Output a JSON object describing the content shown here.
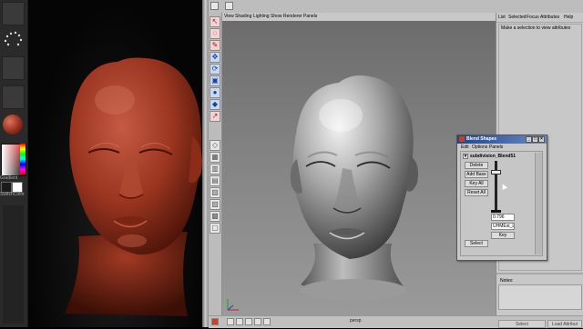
{
  "zbrush": {
    "gradient_label": "Gradient",
    "switch_label": "SwitchColor"
  },
  "maya": {
    "viewport_menu": [
      "View",
      "Shading",
      "Lighting",
      "Show",
      "Renderer",
      "Panels"
    ],
    "camera_label": "persp",
    "attribute_editor": {
      "menu": [
        "List",
        "Selected",
        "Focus",
        "Attributes",
        "Help"
      ],
      "message": "Make a selection to view attributes",
      "notes_label": "Notes:",
      "select_button": "Select",
      "load_button": "Load Attribut"
    },
    "toolbox_icons": [
      "select-tool",
      "lasso-tool",
      "paint-tool",
      "move-tool",
      "rotate-tool",
      "scale-tool",
      "manipulator-tool",
      "soft-mod-tool",
      "last-tool",
      "layout-single",
      "layout-four",
      "layout-side",
      "layout-stacked",
      "layout-outliner",
      "layout-graph",
      "layout-hypershade",
      "layout-script"
    ]
  },
  "blend_shapes": {
    "title": "Blend Shapes",
    "menu": [
      "Edit",
      "Options",
      "Panels"
    ],
    "node_name": "subdivision_Blend51",
    "buttons": [
      "Delete",
      "Add Base",
      "Key All",
      "Reset All"
    ],
    "weight_value": "0.796",
    "target_name": "UHMEst_Lo",
    "key_button": "Key",
    "select_button": "Select",
    "weight_fraction": 0.796
  }
}
